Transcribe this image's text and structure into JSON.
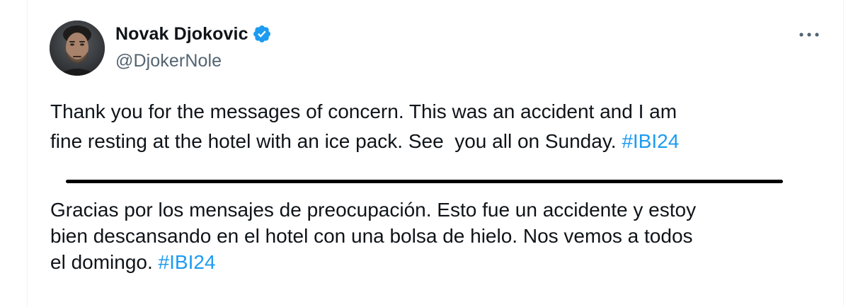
{
  "author": {
    "display_name": "Novak Djokovic",
    "handle": "@DjokerNole",
    "verified": true,
    "avatar_icon": "profile-photo"
  },
  "menu": {
    "icon": "more-horizontal-icon"
  },
  "tweet": {
    "english_line_1": "Thank you for the messages of concern. This was an accident and I am",
    "english_line_2": "fine resting at the hotel with an ice pack. See  you all on Sunday. ",
    "english_hashtag": "#IBI24",
    "spanish_line_1": "Gracias por los mensajes de preocupación. Esto fue un accidente y estoy",
    "spanish_line_2": "bien descansando en el hotel con una bolsa de hielo. Nos vemos a todos",
    "spanish_line_3": "el domingo. ",
    "spanish_hashtag": "#IBI24"
  },
  "colors": {
    "text": "#0f1419",
    "secondary": "#536471",
    "link": "#1d9bf0",
    "verified": "#1d9bf0"
  }
}
